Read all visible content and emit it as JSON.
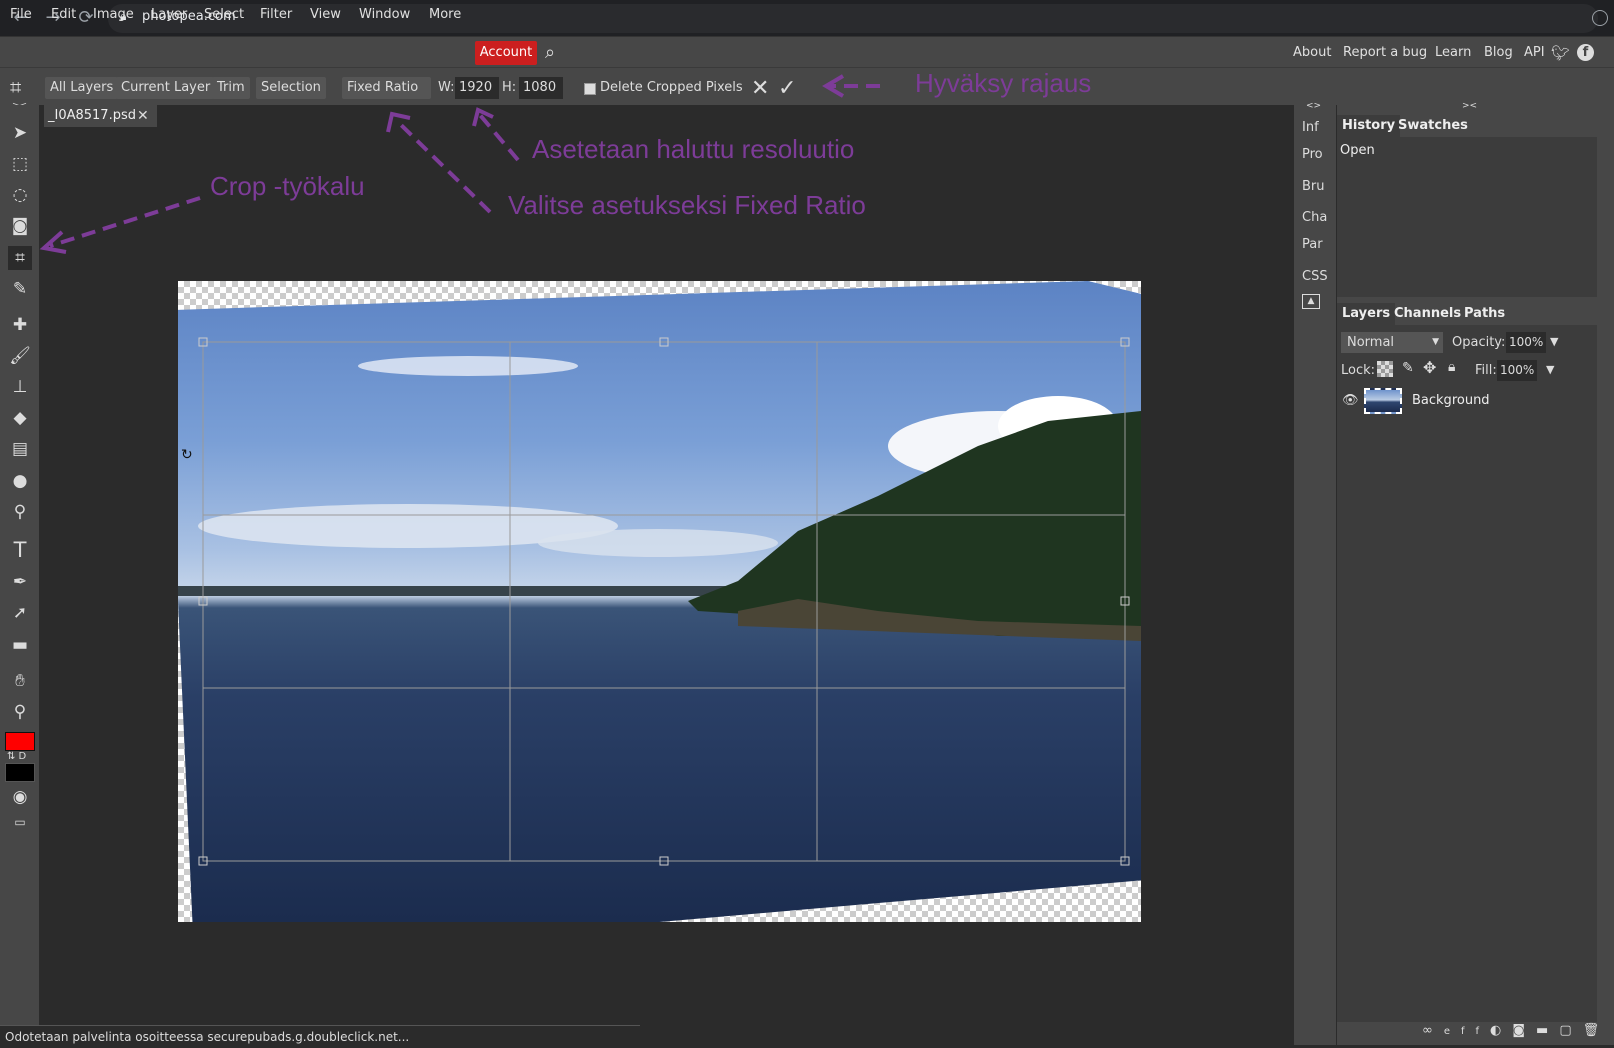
{
  "browser": {
    "url": "photopea.com",
    "back_icon": "←",
    "forward_icon": "→",
    "reload_icon": "⟳"
  },
  "menu": {
    "items": [
      "File",
      "Edit",
      "Image",
      "Layer",
      "Select",
      "Filter",
      "View",
      "Window",
      "More"
    ],
    "account": "Account",
    "right_links": [
      "About",
      "Report a bug",
      "Learn",
      "Blog",
      "API"
    ]
  },
  "options": {
    "all_layers": "All Layers",
    "current_layer": "Current Layer",
    "trim": "Trim",
    "selection": "Selection",
    "fixed_ratio": "Fixed Ratio",
    "w_label": "W:",
    "w_value": "1920",
    "h_label": "H:",
    "h_value": "1080",
    "delete_cropped": "Delete Cropped Pixels"
  },
  "document": {
    "tab_name": "_I0A8517.psd"
  },
  "collapsed_panels": [
    "Inf",
    "Pro",
    "Bru",
    "Cha",
    "Par",
    "CSS"
  ],
  "history": {
    "tabs": [
      "History",
      "Swatches"
    ],
    "items": [
      "Open"
    ]
  },
  "layers": {
    "tabs": [
      "Layers",
      "Channels",
      "Paths"
    ],
    "blend_mode": "Normal",
    "opacity_label": "Opacity:",
    "opacity": "100%",
    "lock_label": "Lock:",
    "fill_label": "Fill:",
    "fill": "100%",
    "items": [
      "Background"
    ]
  },
  "status": {
    "text": "Odotetaan palvelinta osoitteessa securepubads.g.doubleclick.net..."
  },
  "annotations": {
    "accept_crop": "Hyväksy rajaus",
    "set_resolution": "Asetetaan haluttu resoluutio",
    "crop_tool": "Crop -työkalu",
    "fixed_ratio_tip": "Valitse asetukseksi Fixed Ratio"
  },
  "colors": {
    "accent_red": "#cc1f1f",
    "annotation_purple": "#7d3c98",
    "foreground": "#ff0000",
    "background": "#000000"
  }
}
